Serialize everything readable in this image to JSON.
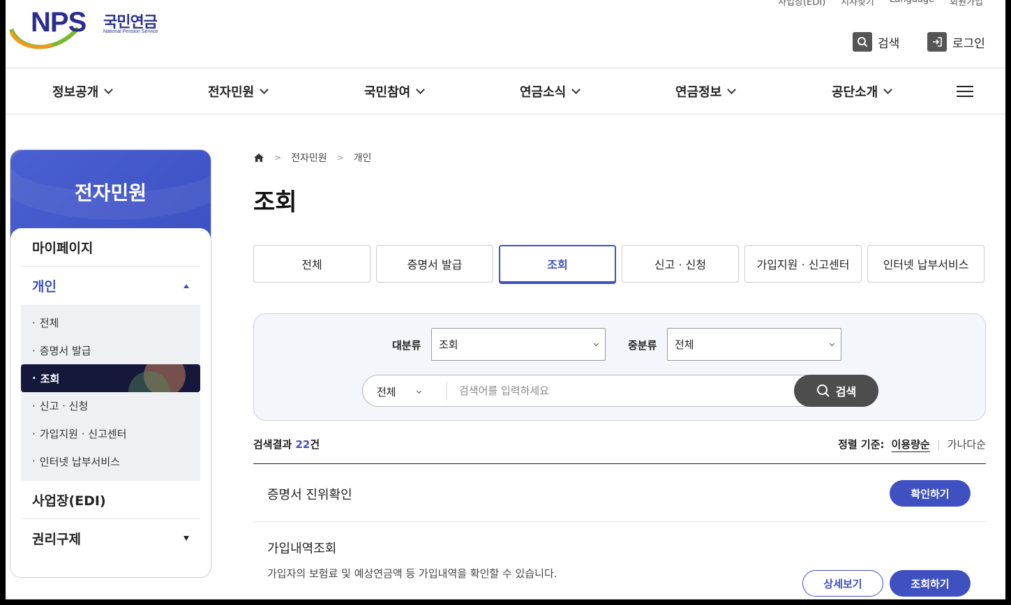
{
  "header": {
    "logo_text": "NPS",
    "logo_kr": "국민연금",
    "logo_en": "National Pension Service",
    "util_links": [
      "사업장(EDI)",
      "지사찾기",
      "Language",
      "회원가입"
    ],
    "search_label": "검색",
    "login_label": "로그인"
  },
  "gnb": {
    "items": [
      {
        "label": "정보공개"
      },
      {
        "label": "전자민원"
      },
      {
        "label": "국민참여"
      },
      {
        "label": "연금소식"
      },
      {
        "label": "연금정보"
      },
      {
        "label": "공단소개"
      }
    ]
  },
  "lnb": {
    "title": "전자민원",
    "items": [
      {
        "label": "마이페이지"
      },
      {
        "label": "개인"
      },
      {
        "label": "사업장(EDI)"
      },
      {
        "label": "권리구제"
      }
    ],
    "sub_items": [
      {
        "label": "전체"
      },
      {
        "label": "증명서 발급"
      },
      {
        "label": "조회"
      },
      {
        "label": "신고 · 신청"
      },
      {
        "label": "가입지원 · 신고센터"
      },
      {
        "label": "인터넷 납부서비스"
      }
    ]
  },
  "breadcrumb": [
    "전자민원",
    "개인"
  ],
  "page_title": "조회",
  "tabs": [
    {
      "label": "전체"
    },
    {
      "label": "증명서 발급"
    },
    {
      "label": "조회"
    },
    {
      "label": "신고 · 신청"
    },
    {
      "label": "가입지원 · 신고센터"
    },
    {
      "label": "인터넷 납부서비스"
    }
  ],
  "search": {
    "category_label": "대분류",
    "category_value": "조회",
    "subcategory_label": "중분류",
    "subcategory_value": "전체",
    "scope_value": "전체",
    "placeholder": "검색어를 입력하세요",
    "button_label": "검색"
  },
  "results": {
    "label": "검색결과",
    "count": "22",
    "unit": "건",
    "sort_label": "정렬 기준:",
    "sort_active": "이용량순",
    "sort_other": "가나다순"
  },
  "list": [
    {
      "title": "증명서 진위확인",
      "button": "확인하기"
    },
    {
      "title": "가입내역조회",
      "desc": "가입자의 보험료 및 예상연금액 등 가입내역을 확인할 수 있습니다.",
      "detail_button": "상세보기",
      "button": "조회하기"
    }
  ],
  "colors": {
    "accent": "#3f51c0",
    "sidebar_active": "#15183b",
    "search_button": "#4d4d4d"
  }
}
